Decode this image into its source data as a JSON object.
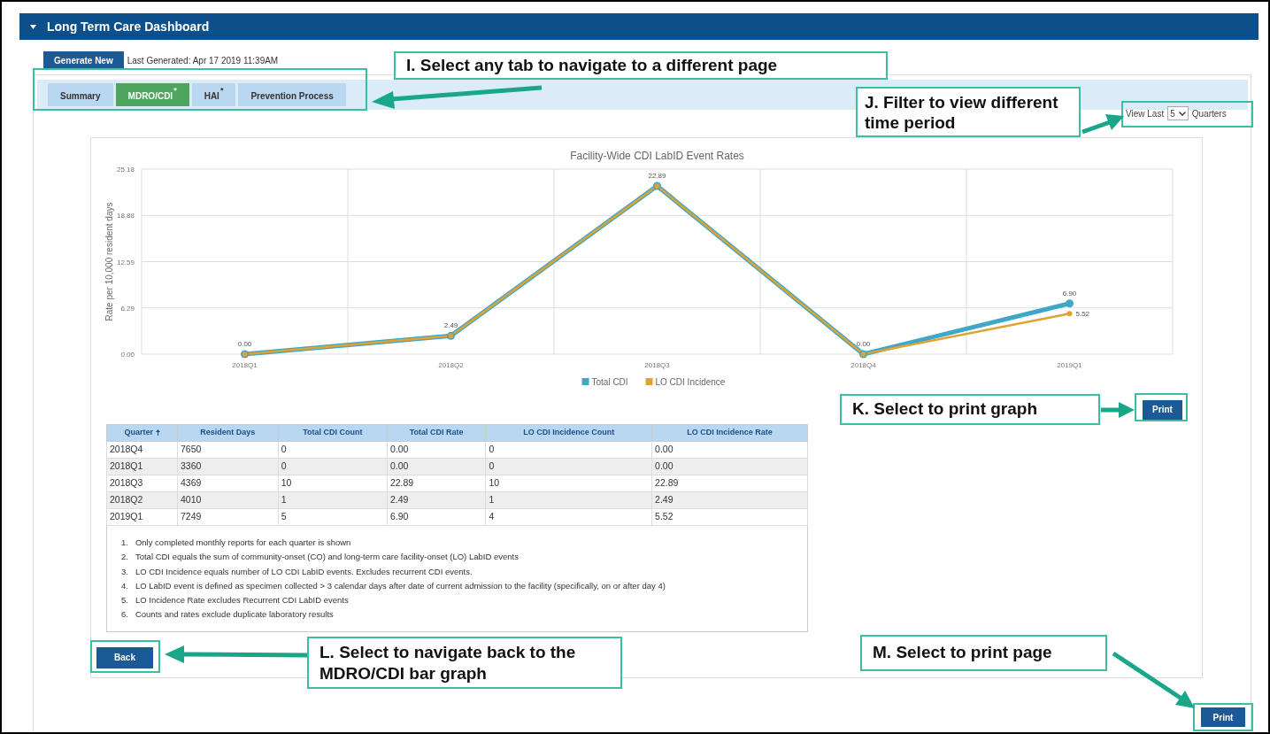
{
  "header": {
    "title": "Long Term Care Dashboard"
  },
  "generate_button": "Generate New",
  "last_generated": "Last Generated: Apr 17 2019 11:39AM",
  "tabs": [
    {
      "label": "Summary",
      "selected": false
    },
    {
      "label": "MDRO/CDI",
      "selected": true,
      "marker": "*"
    },
    {
      "label": "HAI",
      "selected": false,
      "marker": "*"
    },
    {
      "label": "Prevention Process",
      "selected": false
    }
  ],
  "filter": {
    "prefix": "View Last",
    "value": "5",
    "suffix": "Quarters"
  },
  "chart": {
    "chart_data": {
      "type": "line",
      "title": "Facility-Wide CDI LabID Event Rates",
      "ylabel": "Rate per 10,000 resident days",
      "categories": [
        "2018Q1",
        "2018Q2",
        "2018Q3",
        "2018Q4",
        "2019Q1"
      ],
      "series": [
        {
          "name": "Total CDI",
          "color": "#3fa7c7",
          "marker": "circle",
          "values": [
            0,
            2.49,
            22.89,
            0,
            6.9
          ]
        },
        {
          "name": "LO CDI Incidence",
          "color": "#e0a232",
          "marker": "circle",
          "values": [
            0,
            2.49,
            22.89,
            0,
            5.52
          ]
        }
      ],
      "value_labels": [
        [
          "0.00",
          "2.49",
          "22.89",
          "0.00",
          "6.90"
        ],
        [
          null,
          null,
          null,
          null,
          "5.52"
        ]
      ],
      "grid": true,
      "legend": "bottom",
      "ylim": [
        0,
        25.18
      ],
      "yticks": [
        {
          "value": 0,
          "label": "0.00"
        },
        {
          "value": 6.29,
          "label": "6.29"
        },
        {
          "value": 12.59,
          "label": "12.59"
        },
        {
          "value": 18.88,
          "label": "18.88"
        },
        {
          "value": 25.18,
          "label": "25.18"
        }
      ]
    },
    "print_button": "Print"
  },
  "table": {
    "columns": [
      "Quarter",
      "Resident Days",
      "Total CDI Count",
      "Total CDI Rate",
      "LO CDI Incidence Count",
      "LO CDI Incidence Rate"
    ],
    "rows": [
      [
        "2018Q4",
        "7650",
        "0",
        "0.00",
        "0",
        "0.00"
      ],
      [
        "2018Q1",
        "3360",
        "0",
        "0.00",
        "0",
        "0.00"
      ],
      [
        "2018Q3",
        "4369",
        "10",
        "22.89",
        "10",
        "22.89"
      ],
      [
        "2018Q2",
        "4010",
        "1",
        "2.49",
        "1",
        "2.49"
      ],
      [
        "2019Q1",
        "7249",
        "5",
        "6.90",
        "4",
        "5.52"
      ]
    ]
  },
  "notes": [
    {
      "number": "1.",
      "text": "Only completed monthly reports for each quarter is shown"
    },
    {
      "number": "2.",
      "text": "Total CDI equals the sum of community-onset (CO) and long-term care facility-onset (LO) LabID events"
    },
    {
      "number": "3.",
      "text": "LO CDI Incidence equals number of LO CDI LabID events. Excludes recurrent CDI events."
    },
    {
      "number": "4.",
      "text": "LO LabID event is defined as specimen collected > 3 calendar days after date of current admission to the facility (specifically, on or after day 4)"
    },
    {
      "number": "5.",
      "text": "LO Incidence Rate excludes Recurrent CDI LabID events"
    },
    {
      "number": "6.",
      "text": "Counts and rates exclude duplicate laboratory results"
    }
  ],
  "back_button": "Back",
  "print_page_button": "Print",
  "callouts": [
    {
      "text": "I. Select any tab to navigate to a different page"
    },
    {
      "text": "J. Filter to view different time period"
    },
    {
      "text": "K. Select to print graph"
    },
    {
      "text": "L. Select to navigate back to the MDRO/CDI bar graph"
    },
    {
      "text": "M. Select to print page"
    }
  ]
}
